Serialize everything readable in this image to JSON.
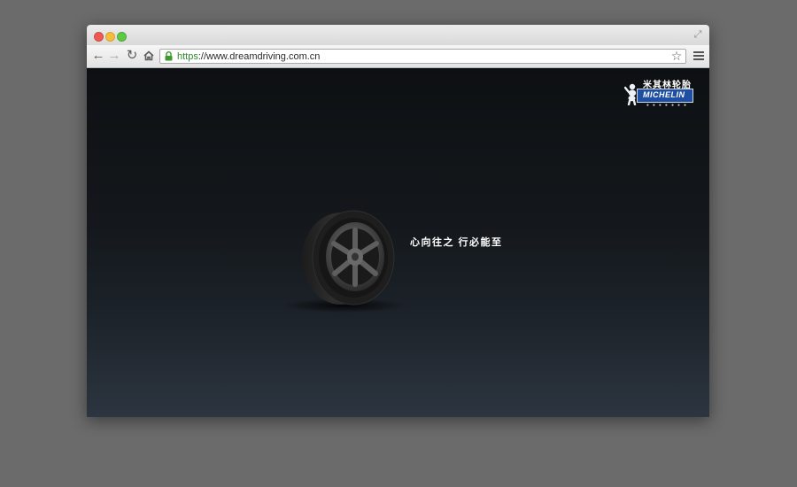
{
  "browser": {
    "url_scheme": "https",
    "url_rest": "://www.dreamdriving.com.cn"
  },
  "icons": {
    "back": "arrow-left-icon",
    "forward": "arrow-right-icon",
    "reload": "reload-icon",
    "home": "home-icon",
    "lock": "lock-icon",
    "bookmark": "star-icon",
    "menu": "hamburger-menu-icon",
    "fullscreen": "fullscreen-icon"
  },
  "page": {
    "brand_cn": "米其林轮胎",
    "brand_en": "MICHELIN",
    "slogan": "心向往之 行必能至"
  },
  "colors": {
    "url_scheme": "#2d8c2d",
    "brand_blue": "#1d4fa3",
    "page_bg_top": "#0d1013",
    "page_bg_bottom": "#2c3540"
  }
}
